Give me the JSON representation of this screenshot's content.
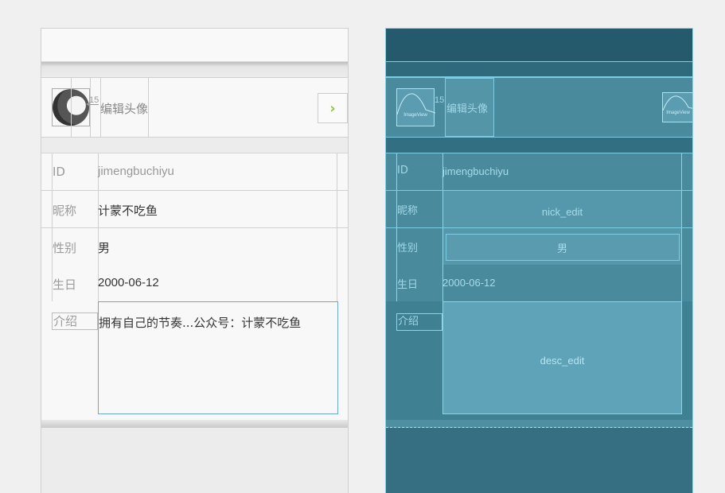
{
  "avatar_row": {
    "label": "编辑头像",
    "margin_value": "15"
  },
  "fields": {
    "id": {
      "label": "ID",
      "value": "jimengbuchiyu"
    },
    "nickname": {
      "label": "昵称",
      "value": "计蒙不吃鱼"
    },
    "gender": {
      "label": "性别",
      "value": "男"
    },
    "birthday": {
      "label": "生日",
      "value": "2000-06-12"
    },
    "intro": {
      "label": "介绍",
      "value": "拥有自己的节奏...公众号：计蒙不吃鱼"
    }
  },
  "blueprint": {
    "image_view_label": "ImageView",
    "nick_edit_label": "nick_edit",
    "gender_value": "男",
    "desc_edit_label": "desc_edit"
  },
  "icons": {
    "next": "chevron-right-icon",
    "avatar": "avatar-image"
  },
  "colors": {
    "accent_green": "#8cc63f",
    "edit_border": "#6aa6d9",
    "blueprint_bg": "#3e7f92"
  }
}
